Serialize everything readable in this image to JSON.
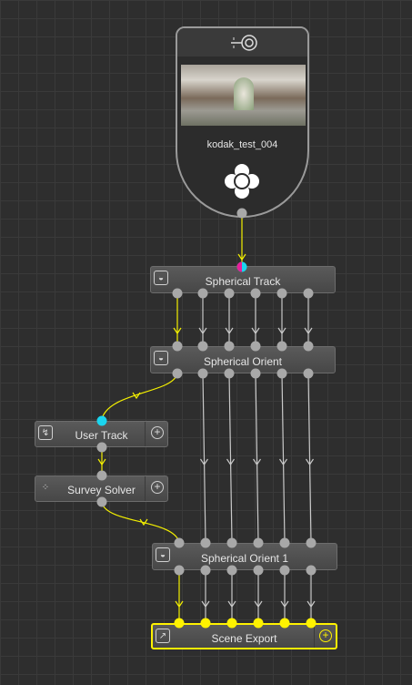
{
  "source": {
    "title": "kodak_test_004"
  },
  "nodes": {
    "spherical_track": {
      "label": "Spherical Track"
    },
    "spherical_orient": {
      "label": "Spherical Orient"
    },
    "user_track": {
      "label": "User Track"
    },
    "survey_solver": {
      "label": "Survey Solver"
    },
    "spherical_orient_1": {
      "label": "Spherical Orient 1"
    },
    "scene_export": {
      "label": "Scene Export"
    }
  },
  "icons": {
    "source_top": "tracker-eye-icon",
    "source_bottom": "flower-move-icon",
    "node_plus": "plus-circle-icon"
  },
  "colors": {
    "background": "#2e2e2e",
    "active_link": "#f4f000",
    "idle_link": "#c9c9c9",
    "port": "#a8a8a8",
    "active_port": "#fff200",
    "cyan_port": "#1ad5ef",
    "magenta_port": "#e91f9b"
  }
}
